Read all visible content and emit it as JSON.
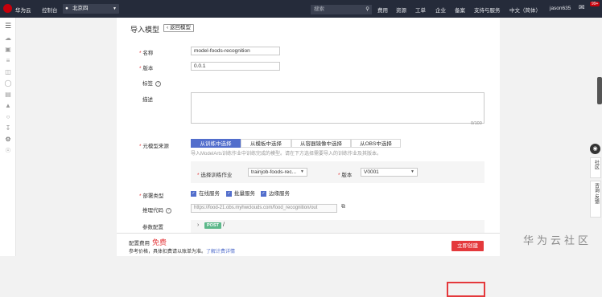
{
  "topbar": {
    "brand": "华为云",
    "console": "控制台",
    "region": "北京四",
    "search_placeholder": "搜索",
    "nav": [
      "费用",
      "资源",
      "工单",
      "企业",
      "备案",
      "支持与服务",
      "中文（简体）",
      "jason635"
    ],
    "badge": "99+"
  },
  "page": {
    "title": "导入模型",
    "back_label": "返回模型"
  },
  "form": {
    "name_label": "名称",
    "name_value": "model-foods-recognition",
    "version_label": "版本",
    "version_value": "0.0.1",
    "tags_label": "标签",
    "desc_label": "描述",
    "desc_counter": "0/100",
    "meta_source_label": "元模型来源",
    "source_tabs": [
      "从训练中选择",
      "从模板中选择",
      "从容器镜像中选择",
      "从OBS中选择"
    ],
    "source_hint": "导入ModelArts训练作业中训练完成的模型。请在下方选择需要导入的训练作业及其版本。",
    "job_label": "选择训练作业",
    "job_value": "trainjob-foods-rec...",
    "job_version_label": "版本",
    "job_version_value": "V0001",
    "deploy_label": "部署类型",
    "deploy_options": [
      "在线服务",
      "批量服务",
      "边缘服务"
    ],
    "inference_label": "推理代码",
    "inference_url": "https://food-21.obs.myhwclouds.com/food_recognition/out",
    "params_label": "参数配置",
    "post_tag": "POST",
    "post_path": "/"
  },
  "footer": {
    "fee_label": "配置费用",
    "fee_value": "免费",
    "price_note": "参考价格，具体扣费请以账单为准。",
    "price_link": "了解计费详情",
    "create_button": "立即创建"
  },
  "watermark": "华为云社区",
  "side_tools": [
    "社区",
    "咨询·反馈"
  ]
}
